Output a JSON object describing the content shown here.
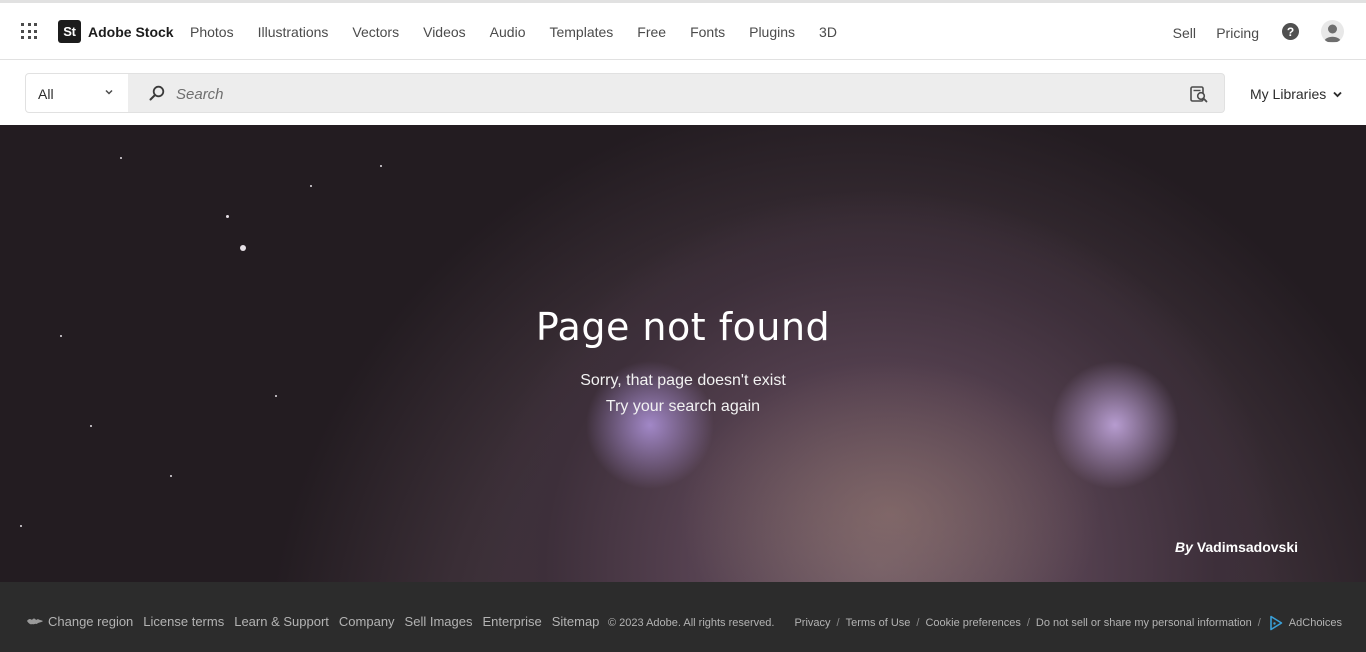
{
  "header": {
    "logo_badge": "St",
    "logo_text": "Adobe Stock",
    "nav": [
      "Photos",
      "Illustrations",
      "Vectors",
      "Videos",
      "Audio",
      "Templates",
      "Free",
      "Fonts",
      "Plugins",
      "3D"
    ],
    "sell": "Sell",
    "pricing": "Pricing",
    "help_glyph": "?"
  },
  "search": {
    "category": "All",
    "placeholder": "Search",
    "my_libraries": "My Libraries"
  },
  "hero": {
    "title": "Page not found",
    "subtitle_1": "Sorry, that page doesn't exist",
    "subtitle_2": "Try your search again",
    "credit_prefix": "By",
    "credit_name": "Vadimsadovski"
  },
  "footer": {
    "left_links": [
      "Change region",
      "License terms",
      "Learn & Support",
      "Company",
      "Sell Images",
      "Enterprise",
      "Sitemap"
    ],
    "copyright": "© 2023 Adobe. All rights reserved.",
    "right_links": [
      "Privacy",
      "Terms of Use",
      "Cookie preferences",
      "Do not sell or share my personal information"
    ],
    "adchoices": "AdChoices"
  },
  "icons": {
    "apps": "grid-icon",
    "search": "search-icon",
    "visual_search": "visual-search-icon",
    "chevron": "chevron-down-icon",
    "help": "help-icon",
    "avatar": "user-avatar-icon",
    "globe": "globe-icon",
    "adchoices": "adchoices-icon"
  },
  "colors": {
    "header_bg": "#ffffff",
    "search_bg": "#ededed",
    "footer_bg": "#2c2c2c",
    "footer_text": "#b3b3b3",
    "logo_bg": "#1c1c1c",
    "adchoices_accent": "#3aa0d8"
  }
}
